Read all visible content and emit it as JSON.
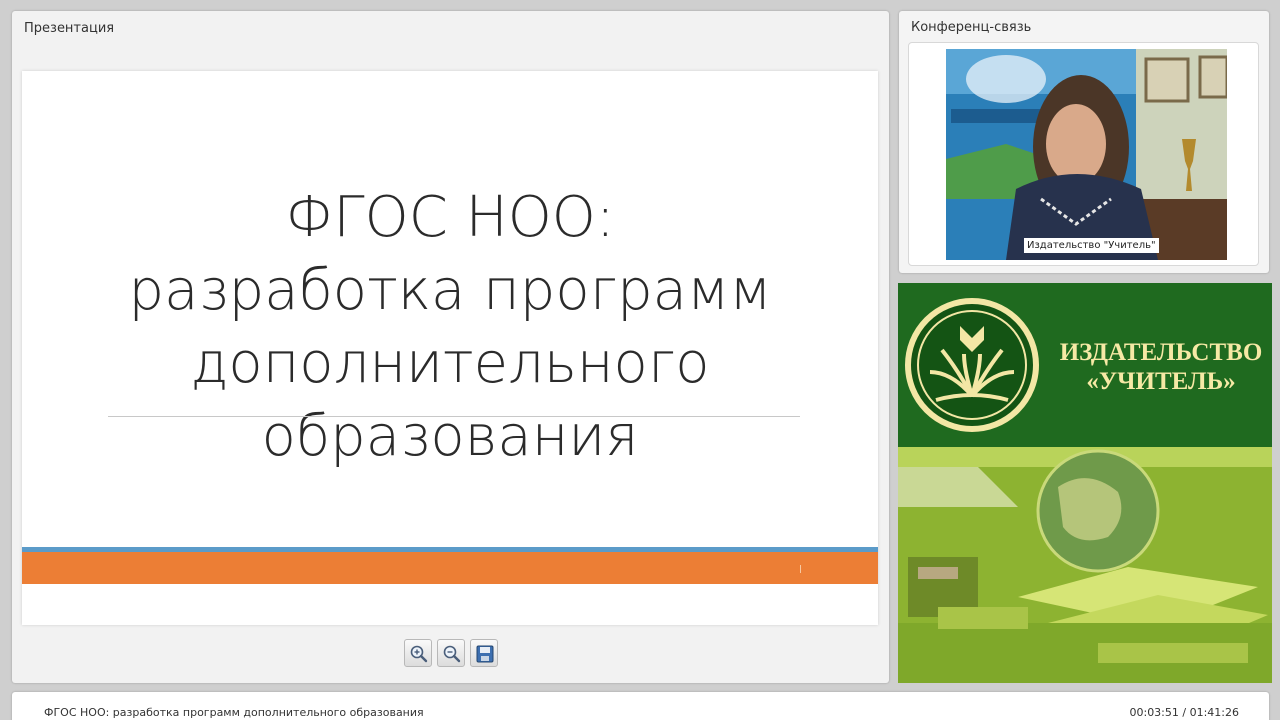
{
  "presentation": {
    "panel_title": "Презентация",
    "slide": {
      "title_lines": [
        "ФГОС НОО:",
        "разработка программ",
        "дополнительного",
        "образования"
      ],
      "accent_blue": "#5b9bc9",
      "accent_orange": "#ec7e35"
    },
    "toolbar": [
      {
        "icon": "zoom-in-icon"
      },
      {
        "icon": "zoom-out-icon"
      },
      {
        "icon": "save-icon"
      }
    ]
  },
  "conference": {
    "panel_title": "Конференц-связь",
    "video_label": "Издательство \"Учитель\""
  },
  "publisher": {
    "name_line1": "ИЗДАТЕЛЬСТВО",
    "name_line2": "«УЧИТЕЛЬ»",
    "brand_green": "#1f6a1f",
    "brand_gold": "#f6e9a5"
  },
  "footer": {
    "title": "ФГОС НОО: разработка программ дополнительного образования",
    "timecode": "00:03:51 / 01:41:26"
  }
}
